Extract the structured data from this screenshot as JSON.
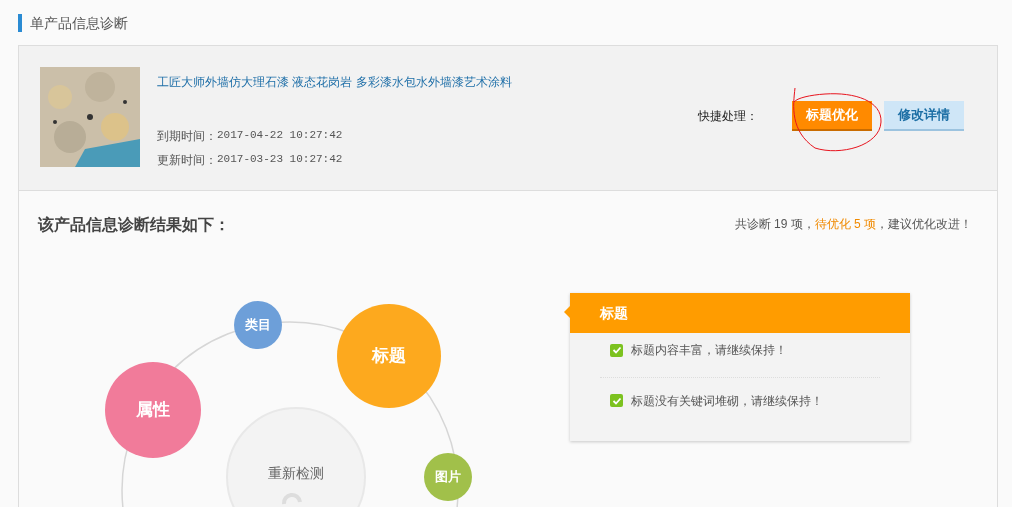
{
  "section_title": "单产品信息诊断",
  "product": {
    "title": "工匠大师外墙仿大理石漆 液态花岗岩 多彩漆水包水外墙漆艺术涂料",
    "expire_label": "到期时间：",
    "expire": "2017-04-22 10:27:42",
    "update_label": "更新时间：",
    "update": "2017-03-23 10:27:42"
  },
  "quick": {
    "label": "快捷处理：",
    "buttons": [
      {
        "label": "标题优化",
        "kind": "primary"
      },
      {
        "label": "修改详情",
        "kind": "secondary"
      }
    ],
    "annotation": true
  },
  "result": {
    "heading": "该产品信息诊断结果如下：",
    "summary": "共诊断 19 项，",
    "pending": "待优化 5 项",
    "advice": "，建议优化改进！"
  },
  "diagram": {
    "center": "重新检测",
    "nodes": [
      {
        "label": "类目",
        "color": "#6d9fd9"
      },
      {
        "label": "标题",
        "color": "#fda91e"
      },
      {
        "label": "属性",
        "color": "#f17b9a"
      },
      {
        "label": "图片",
        "color": "#a1c04a"
      }
    ]
  },
  "detail": {
    "title": "标题",
    "items": [
      {
        "text": "标题内容丰富，请继续保持！",
        "checked": true
      },
      {
        "text": "标题没有关键词堆砌，请继续保持！",
        "checked": true
      }
    ]
  }
}
